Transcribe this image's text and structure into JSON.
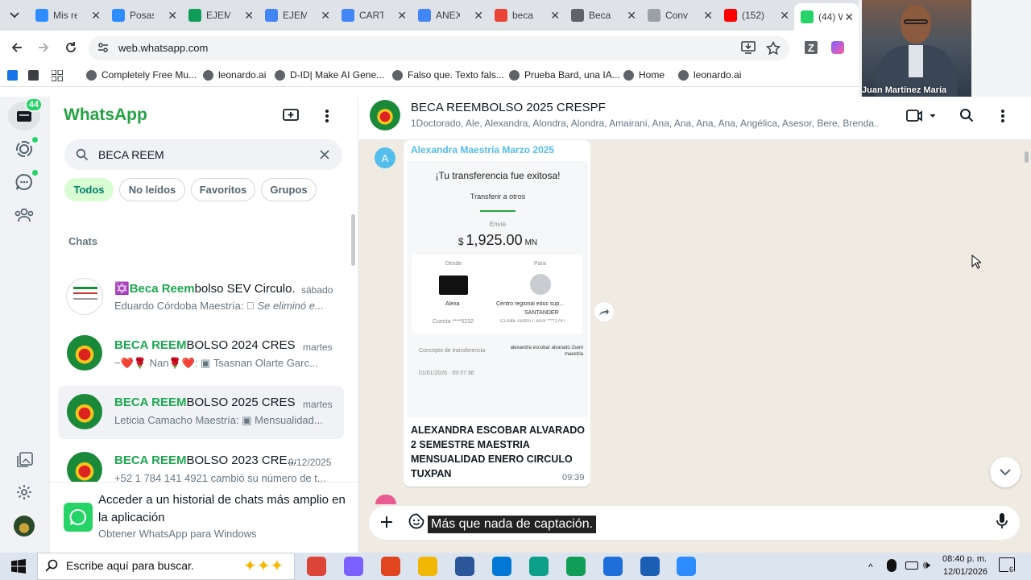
{
  "browser": {
    "tabs": [
      {
        "label": "Mis re",
        "color": "#2d8cff",
        "glyph": "zm"
      },
      {
        "label": "Posas",
        "color": "#2d8cff",
        "glyph": "zm"
      },
      {
        "label": "EJEM",
        "color": "#0f9d58",
        "glyph": "drive"
      },
      {
        "label": "EJEM",
        "color": "#4285f4",
        "glyph": "doc"
      },
      {
        "label": "CART",
        "color": "#4285f4",
        "glyph": "doc"
      },
      {
        "label": "ANEX",
        "color": "#4285f4",
        "glyph": "doc"
      },
      {
        "label": "beca",
        "color": "#ea4335",
        "glyph": "G"
      },
      {
        "label": "Beca",
        "color": "#5f6368",
        "glyph": "gpt"
      },
      {
        "label": "Conv",
        "color": "#9aa0a6",
        "glyph": "claude"
      },
      {
        "label": "(152)",
        "color": "#ff0000",
        "glyph": "yt"
      },
      {
        "label": "(44) W",
        "color": "#25d366",
        "glyph": "wa"
      }
    ],
    "url": "web.whatsapp.com",
    "bookmarks": [
      "Completely Free Mu...",
      "leonardo.ai",
      "D-ID| Make AI Gene...",
      "Falso que. Texto fals...",
      "Prueba Bard, una IA...",
      "Home",
      "leonardo.ai"
    ]
  },
  "webcam": {
    "name": "Juan Martínez María"
  },
  "rail": {
    "unread_badge": "44"
  },
  "sidebar": {
    "title": "WhatsApp",
    "search_value": "BECA REEM",
    "filters": [
      "Todos",
      "No leídos",
      "Favoritos",
      "Grupos"
    ],
    "section_label": "Chats",
    "chats": [
      {
        "title_hl": "Beca Reem",
        "title_rest": "bolso SEV Circulo...",
        "date": "sábado",
        "sender": "Eduardo Córdoba Maestría:",
        "preview": "Se eliminó e...",
        "prefix": "✡️"
      },
      {
        "title_hl": "BECA REEM",
        "title_rest": "BOLSO 2024 CRESPF",
        "date": "martes",
        "sender": "~❤️🌹 Nan🌹❤️:",
        "preview": "Tsasnan Olarte Garc...",
        "prefix": ""
      },
      {
        "title_hl": "BECA REEM",
        "title_rest": "BOLSO 2025 CRESPF",
        "date": "martes",
        "sender": "Leticia Camacho Maestría:",
        "preview": "Mensualidad...",
        "prefix": ""
      },
      {
        "title_hl": "BECA REEM",
        "title_rest": "BOLSO 2023 CRE...",
        "date": "9/12/2025",
        "sender": "+52 1 784 141 4921 cambió su número de t...",
        "preview": "",
        "prefix": ""
      }
    ],
    "promo": {
      "title": "Acceder a un historial de chats más amplio en la aplicación",
      "link": "Obtener WhatsApp para Windows"
    }
  },
  "chat": {
    "title": "BECA REEMBOLSO 2025 CRESPF",
    "members": "1Doctorado, Ale, Alexandra, Alondra, Alondra, Amairani, Ana, Ana, Ana, Ana, Angélica, Asesor, Bere, Brenda...",
    "message": {
      "avatar_letter": "A",
      "sender": "Alexandra Maestría Marzo 2025",
      "receipt": {
        "headline": "¡Tu transferencia fue exitosa!",
        "subtitle": "Transferir a otros",
        "sent_label": "Envíe",
        "currency_symbol": "$",
        "amount": "1,925.00",
        "currency": "MN",
        "from_label": "Desde",
        "to_label": "Para",
        "from_name": "Alexa",
        "to_name": "Centro regional educ sup...",
        "to_bank": "SANTANDER",
        "from_account": "Cuenta ****5232",
        "to_account": "CLABE centro r..erior ****2747",
        "concept_label": "Concepto de transferencia",
        "concept_value": "alexandra escobar alvarado 2sem maestria",
        "date": "01/01/2026 · 09:37:36"
      },
      "caption": "ALEXANDRA ESCOBAR ALVARADO 2 SEMESTRE MAESTRIA MENSUALIDAD ENERO CIRCULO TUXPAN",
      "time": "09:39"
    },
    "composer_text": "Más que nada de captación."
  },
  "taskbar": {
    "search_placeholder": "Escribe aquí para buscar.",
    "time": "08:40 p. m.",
    "date": "12/01/2026",
    "notifications": "6"
  }
}
